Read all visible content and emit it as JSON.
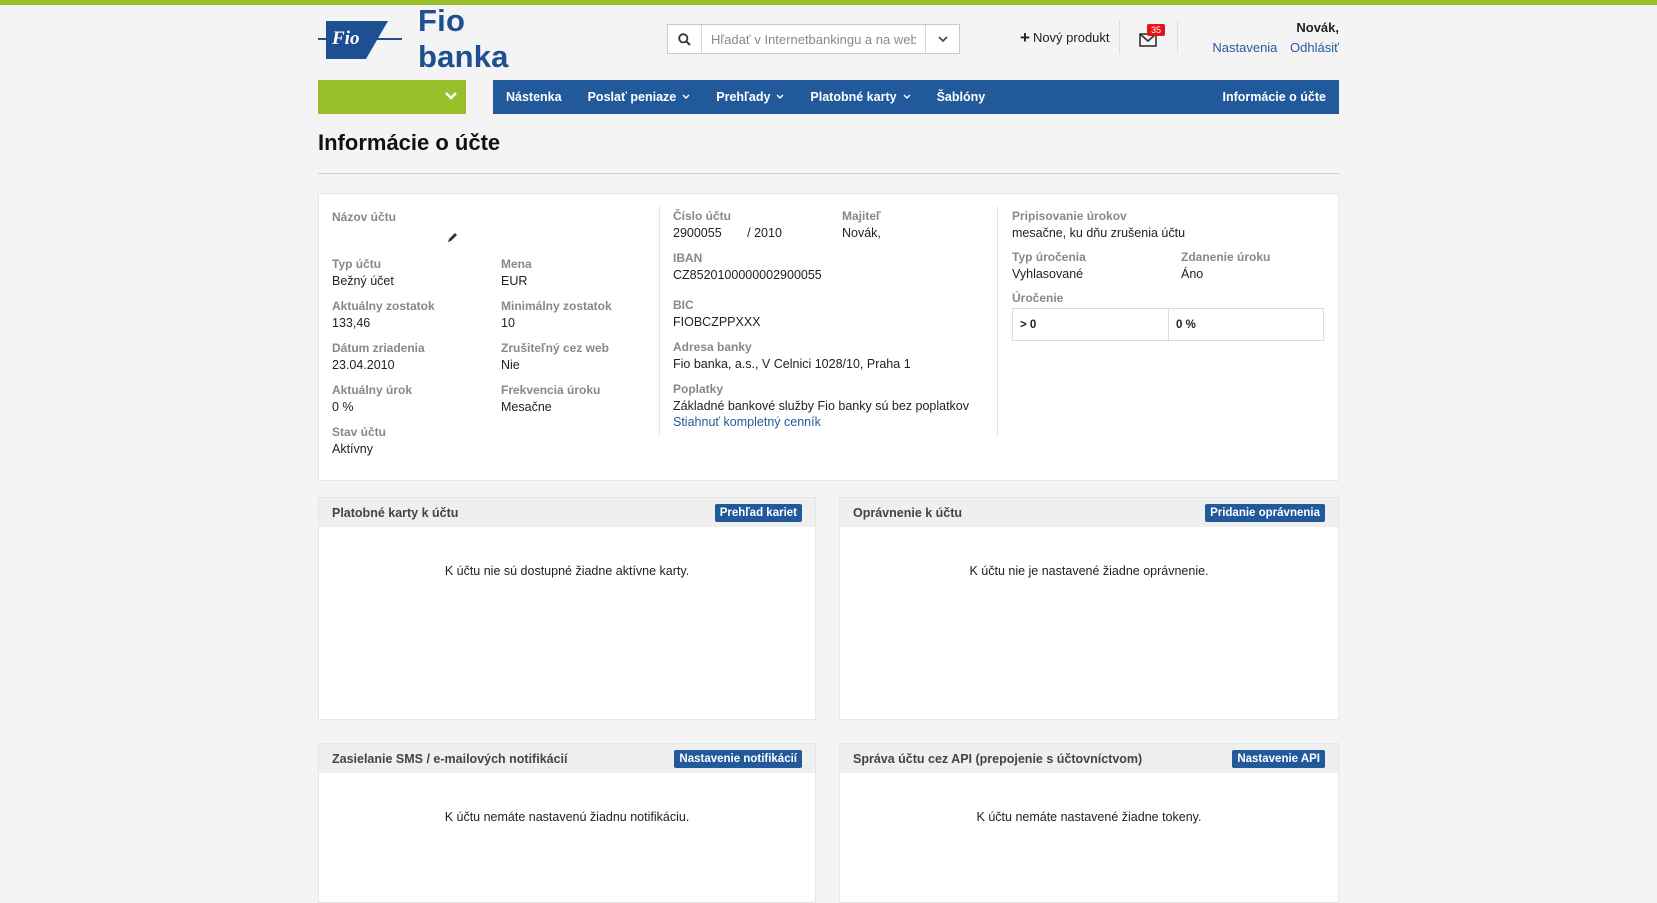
{
  "colors": {
    "top_stripe": "#99c02a",
    "nav_blue": "#21599b",
    "account_green": "#99c02a",
    "logo_blue": "#1d4f91",
    "link_blue": "#235b9a",
    "badge_red": "#e4141b"
  },
  "header": {
    "logo_text": "Fio banka",
    "logo_mark_text": "Fio",
    "search": {
      "placeholder": "Hľadať v Internetbankingu a na webe Fio",
      "icon": "search-icon"
    },
    "new_product_label": "Nový produkt",
    "mail_badge": "35",
    "user": {
      "name": "Novák,",
      "settings_label": "Nastavenia",
      "logout_label": "Odhlásiť"
    }
  },
  "nav": {
    "items": [
      {
        "label": "Nástenka",
        "dropdown": false
      },
      {
        "label": "Poslať peniaze",
        "dropdown": true
      },
      {
        "label": "Prehľady",
        "dropdown": true
      },
      {
        "label": "Platobné karty",
        "dropdown": true
      },
      {
        "label": "Šablóny",
        "dropdown": false
      }
    ],
    "right_label": "Informácie o účte"
  },
  "page": {
    "title": "Informácie o účte"
  },
  "account": {
    "name_label": "Názov účtu",
    "type_label": "Typ účtu",
    "type_value": "Bežný účet",
    "currency_label": "Mena",
    "currency_value": "EUR",
    "balance_label": "Aktuálny zostatok",
    "balance_value": "133,46",
    "min_balance_label": "Minimálny zostatok",
    "min_balance_value": "10",
    "created_label": "Dátum zriadenia",
    "created_value": "23.04.2010",
    "cancel_web_label": "Zrušiteľný cez web",
    "cancel_web_value": "Nie",
    "interest_label": "Aktuálny úrok",
    "interest_value": "0 %",
    "interest_freq_label": "Frekvencia úroku",
    "interest_freq_value": "Mesačne",
    "state_label": "Stav účtu",
    "state_value": "Aktívny",
    "number_label": "Číslo účtu",
    "number_value": "2900055",
    "bank_code_value": "/ 2010",
    "owner_label": "Majiteľ",
    "owner_value": "Novák,",
    "iban_label": "IBAN",
    "iban_value": "CZ8520100000002900055",
    "bic_label": "BIC",
    "bic_value": "FIOBCZPPXXX",
    "bank_address_label": "Adresa banky",
    "bank_address_value": "Fio banka, a.s., V Celnici 1028/10, Praha 1",
    "fees_label": "Poplatky",
    "fees_value": "Základné bankové služby Fio banky sú bez poplatkov",
    "fees_link": "Stiahnuť kompletný cenník",
    "crediting_label": "Pripisovanie úrokov",
    "crediting_value": "mesačne, ku dňu zrušenia účtu",
    "interest_type_label": "Typ úročenia",
    "interest_type_value": "Vyhlasované",
    "taxation_label": "Zdanenie úroku",
    "taxation_value": "Áno",
    "rates_label": "Úročenie",
    "rates": [
      {
        "range": "> 0",
        "rate": "0 %"
      }
    ]
  },
  "panels": {
    "cards": {
      "title": "Platobné karty k účtu",
      "button": "Prehľad kariet",
      "empty": "K účtu nie sú dostupné žiadne aktívne karty."
    },
    "permissions": {
      "title": "Oprávnenie k účtu",
      "button": "Pridanie oprávnenia",
      "empty": "K účtu nie je nastavené žiadne oprávnenie."
    },
    "notifications": {
      "title": "Zasielanie SMS / e-mailových notifikácií",
      "button": "Nastavenie notifikácií",
      "empty": "K účtu nemáte nastavenú žiadnu notifikáciu."
    },
    "api": {
      "title": "Správa účtu cez API (prepojenie s účtovníctvom)",
      "button": "Nastavenie API",
      "empty": "K účtu nemáte nastavené žiadne tokeny."
    }
  }
}
